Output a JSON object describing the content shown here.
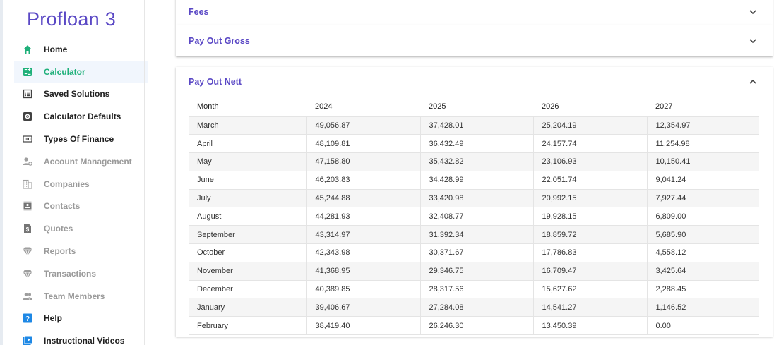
{
  "app": {
    "logo": "Profloan 3"
  },
  "sidebar": {
    "items": [
      {
        "label": "Home",
        "icon": "home-icon"
      },
      {
        "label": "Calculator",
        "icon": "calculator-icon"
      },
      {
        "label": "Saved Solutions",
        "icon": "list-icon"
      },
      {
        "label": "Calculator Defaults",
        "icon": "gear-icon"
      },
      {
        "label": "Types Of Finance",
        "icon": "numeric-icon"
      },
      {
        "label": "Account Management",
        "icon": "account-gear-icon"
      },
      {
        "label": "Companies",
        "icon": "building-icon"
      },
      {
        "label": "Contacts",
        "icon": "contact-card-icon"
      },
      {
        "label": "Quotes",
        "icon": "dollar-document-icon"
      },
      {
        "label": "Reports",
        "icon": "diamond-icon"
      },
      {
        "label": "Transactions",
        "icon": "diamond-icon"
      },
      {
        "label": "Team Members",
        "icon": "people-icon"
      },
      {
        "label": "Help",
        "icon": "question-icon"
      },
      {
        "label": "Instructional Videos",
        "icon": "video-icon"
      }
    ],
    "active": "Calculator",
    "colors": {
      "accent": "#1fb07a",
      "help": "#1e88e5",
      "video": "#1e88e5"
    }
  },
  "panels": {
    "fees": {
      "title": "Fees"
    },
    "gross": {
      "title": "Pay Out Gross"
    },
    "nett": {
      "title": "Pay Out Nett"
    }
  },
  "table": {
    "headers": [
      "Month",
      "2024",
      "2025",
      "2026",
      "2027"
    ],
    "rows": [
      [
        "March",
        "49,056.87",
        "37,428.01",
        "25,204.19",
        "12,354.97"
      ],
      [
        "April",
        "48,109.81",
        "36,432.49",
        "24,157.74",
        "11,254.98"
      ],
      [
        "May",
        "47,158.80",
        "35,432.82",
        "23,106.93",
        "10,150.41"
      ],
      [
        "June",
        "46,203.83",
        "34,428.99",
        "22,051.74",
        "9,041.24"
      ],
      [
        "July",
        "45,244.88",
        "33,420.98",
        "20,992.15",
        "7,927.44"
      ],
      [
        "August",
        "44,281.93",
        "32,408.77",
        "19,928.15",
        "6,809.00"
      ],
      [
        "September",
        "43,314.97",
        "31,392.34",
        "18,859.72",
        "5,685.90"
      ],
      [
        "October",
        "42,343.98",
        "30,371.67",
        "17,786.83",
        "4,558.12"
      ],
      [
        "November",
        "41,368.95",
        "29,346.75",
        "16,709.47",
        "3,425.64"
      ],
      [
        "December",
        "40,389.85",
        "28,317.56",
        "15,627.62",
        "2,288.45"
      ],
      [
        "January",
        "39,406.67",
        "27,284.08",
        "14,541.27",
        "1,146.52"
      ],
      [
        "February",
        "38,419.40",
        "26,246.30",
        "13,450.39",
        "0.00"
      ]
    ]
  },
  "colors": {
    "brand": "#5a48c5",
    "accent": "#1fb07a"
  }
}
